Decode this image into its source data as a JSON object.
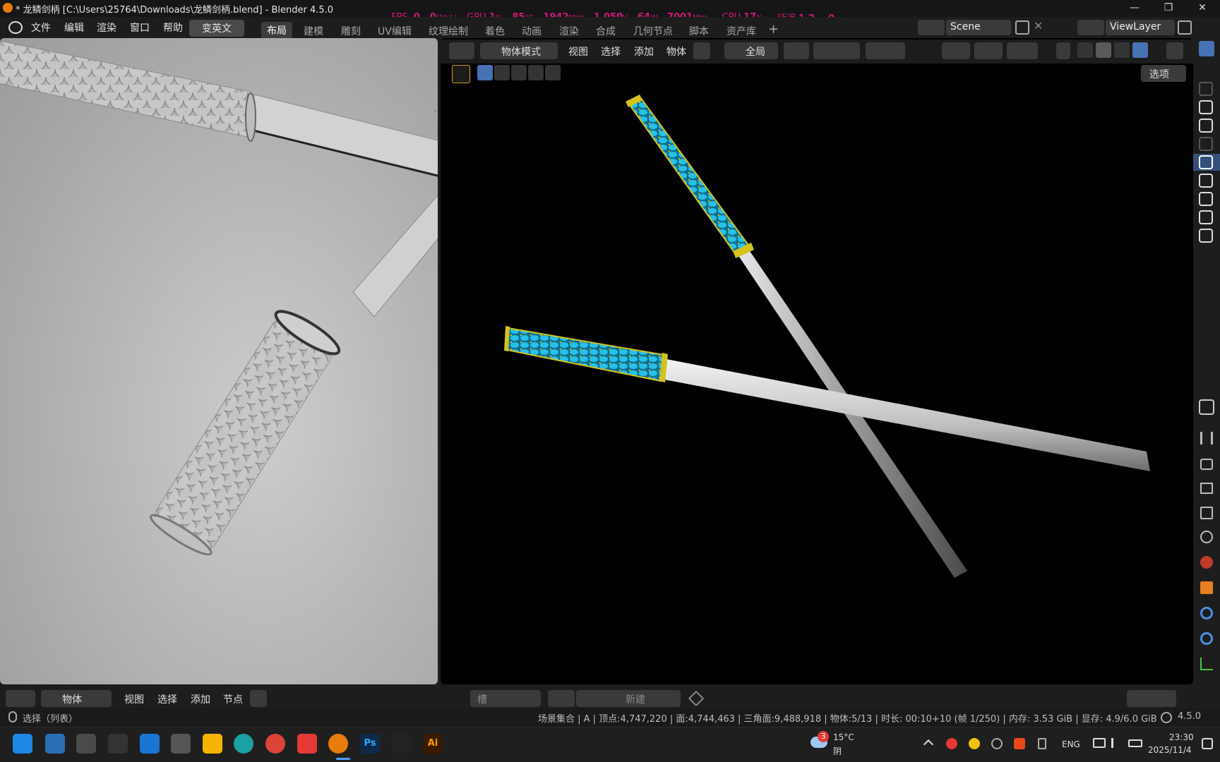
{
  "titlebar": {
    "title": "* 龙鳞剑柄 [C:\\Users\\25764\\Downloads\\龙鳞剑柄.blend] - Blender 4.5.0",
    "controls": [
      "—",
      "❐",
      "✕"
    ]
  },
  "perf_overlay": {
    "fps_label": "FPS",
    "fps_value": "0",
    "fps_low": "0",
    "fps_low_unit": "(1%L)",
    "gpu_label": "GPU",
    "gpu_usage": "1",
    "gpu_usage_unit": "%",
    "gpu_temp": "85",
    "gpu_temp_unit": "°C",
    "gpu_clock": "1942",
    "gpu_clock_unit": "MHz",
    "gpu_volt": "1.050",
    "gpu_volt_unit": "V",
    "gpu_power": "64",
    "gpu_power_unit": "W",
    "mem_clock": "7001",
    "mem_clock_unit": "MHz",
    "cpu_label": "CPU",
    "cpu_usage": "17",
    "cpu_usage_unit": "%",
    "latency_label": "延迟",
    "latency_a": "1.2",
    "latency_a_unit": "ms",
    "latency_b": "0",
    "latency_b_unit": "ms"
  },
  "menubar": {
    "items": [
      "文件",
      "编辑",
      "渲染",
      "窗口",
      "帮助"
    ],
    "translate_button": "变英文",
    "workspaces": [
      "布局",
      "建模",
      "雕刻",
      "UV编辑",
      "纹理绘制",
      "着色",
      "动画",
      "渲染",
      "合成",
      "几何节点",
      "脚本",
      "资产库"
    ],
    "active_workspace": "布局",
    "add_workspace": "+",
    "scene": "Scene",
    "view_layer": "ViewLayer"
  },
  "viewport_header": {
    "mode": "物体模式",
    "menus": [
      "视图",
      "选择",
      "添加",
      "物体"
    ],
    "transform_orientation": "全局",
    "options_button": "选项"
  },
  "bottom_header": {
    "mode": "物体",
    "menus": [
      "视图",
      "选择",
      "添加",
      "节点"
    ],
    "slot": "槽",
    "new_button": "新建"
  },
  "status": {
    "left": "选择（列表）",
    "stats": "场景集合 | A | 顶点:4,747,220 | 面:4,744,463 | 三角面:9,488,918 | 物体:5/13 | 时长: 00:10+10 (帧 1/250) | 内存: 3.53 GiB | 显存: 4.9/6.0 GiB",
    "version": "4.5.0"
  },
  "taskbar": {
    "apps": [
      "windows-start",
      "weather-app",
      "camera-app",
      "unity",
      "vscode-like",
      "calculator",
      "file-explorer",
      "edge",
      "chrome",
      "netease-music",
      "blender",
      "photoshop",
      "inkscape-like",
      "illustrator"
    ],
    "ps_label": "Ps",
    "ai_label": "Ai",
    "weather_badge": "3",
    "temperature": "15°C",
    "weather": "阴",
    "lang": "ENG",
    "time": "23:30",
    "date": "2025/11/4"
  },
  "colors": {
    "perf_magenta": "#d1187a",
    "accent_blue": "#4772b3",
    "hilt_cyan": "#1fb3d8",
    "gold": "#d4c21e"
  }
}
